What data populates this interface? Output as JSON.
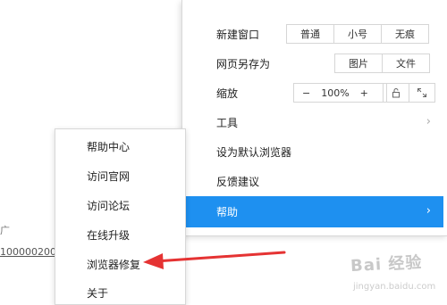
{
  "background": {
    "fragment_text": "广",
    "fragment_link": "100000200"
  },
  "main_menu": {
    "new_window": {
      "label": "新建窗口",
      "options": [
        "普通",
        "小号",
        "无痕"
      ]
    },
    "save_as": {
      "label": "网页另存为",
      "options": [
        "图片",
        "文件"
      ]
    },
    "zoom": {
      "label": "缩放",
      "minus": "−",
      "value": "100%",
      "plus": "+"
    },
    "tools": {
      "label": "工具",
      "chevron": "›"
    },
    "set_default": {
      "label": "设为默认浏览器"
    },
    "feedback": {
      "label": "反馈建议"
    },
    "help": {
      "label": "帮助",
      "chevron": "›"
    }
  },
  "help_submenu": {
    "items": [
      "帮助中心",
      "访问官网",
      "访问论坛",
      "在线升级",
      "浏览器修复",
      "关于"
    ]
  },
  "annotation": {
    "color": "#e53333",
    "target": "浏览器修复"
  },
  "colors": {
    "accent": "#1e90f0"
  },
  "icons": [
    "lock-icon",
    "fullscreen-icon",
    "chevron-right-icon"
  ],
  "watermark": {
    "text": "Bai 经验",
    "sub": "jingyan.baidu.com"
  }
}
